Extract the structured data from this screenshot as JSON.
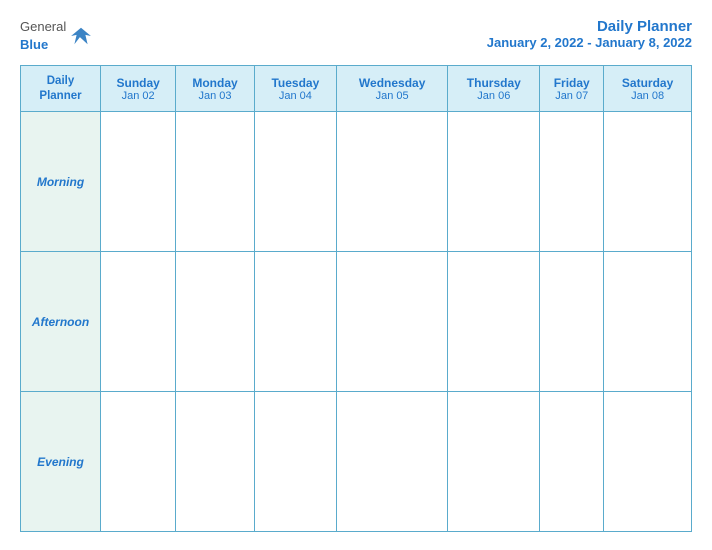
{
  "header": {
    "logo": {
      "general": "General",
      "blue": "Blue",
      "bird_label": "general-blue-logo-bird"
    },
    "title": "Daily Planner",
    "subtitle": "January 2, 2022 - January 8, 2022"
  },
  "table": {
    "header_col": {
      "line1": "Daily",
      "line2": "Planner"
    },
    "days": [
      {
        "name": "Sunday",
        "date": "Jan 02"
      },
      {
        "name": "Monday",
        "date": "Jan 03"
      },
      {
        "name": "Tuesday",
        "date": "Jan 04"
      },
      {
        "name": "Wednesday",
        "date": "Jan 05"
      },
      {
        "name": "Thursday",
        "date": "Jan 06"
      },
      {
        "name": "Friday",
        "date": "Jan 07"
      },
      {
        "name": "Saturday",
        "date": "Jan 08"
      }
    ],
    "rows": [
      {
        "label": "Morning"
      },
      {
        "label": "Afternoon"
      },
      {
        "label": "Evening"
      }
    ]
  }
}
